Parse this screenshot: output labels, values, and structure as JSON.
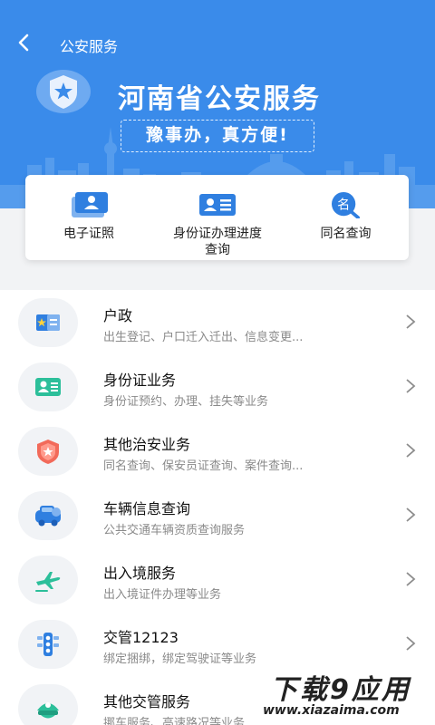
{
  "nav": {
    "title": "公安服务"
  },
  "hero": {
    "title": "河南省公安服务",
    "slogan": "豫事办，真方便!"
  },
  "quick_actions": [
    {
      "label": "电子证照",
      "icon": "id-card-icon"
    },
    {
      "label": "身份证办理进度查询",
      "label_line1": "身份证办理进度",
      "label_line2": "查询",
      "icon": "id-progress-icon"
    },
    {
      "label": "同名查询",
      "icon": "name-search-icon"
    }
  ],
  "services": [
    {
      "title": "户政",
      "subtitle": "出生登记、户口迁入迁出、信息变更...",
      "icon": "household-icon"
    },
    {
      "title": "身份证业务",
      "subtitle": "身份证预约、办理、挂失等业务",
      "icon": "id-card-icon"
    },
    {
      "title": "其他治安业务",
      "subtitle": "同名查询、保安员证查询、案件查询...",
      "icon": "police-badge-icon"
    },
    {
      "title": "车辆信息查询",
      "subtitle": "公共交通车辆资质查询服务",
      "icon": "vehicle-icon"
    },
    {
      "title": "出入境服务",
      "subtitle": "出入境证件办理等业务",
      "icon": "airplane-icon"
    },
    {
      "title": "交管12123",
      "subtitle": "绑定捆绑，绑定驾驶证等业务",
      "icon": "traffic-light-icon"
    },
    {
      "title": "其他交管服务",
      "subtitle": "挪车服务、高速路况等业务",
      "icon": "traffic-police-cap-icon"
    }
  ],
  "watermark": {
    "main": "下载9应用",
    "sub": "www.xiazaima.com"
  },
  "colors": {
    "primary": "#3a8bea",
    "background": "#f2f3f5"
  }
}
